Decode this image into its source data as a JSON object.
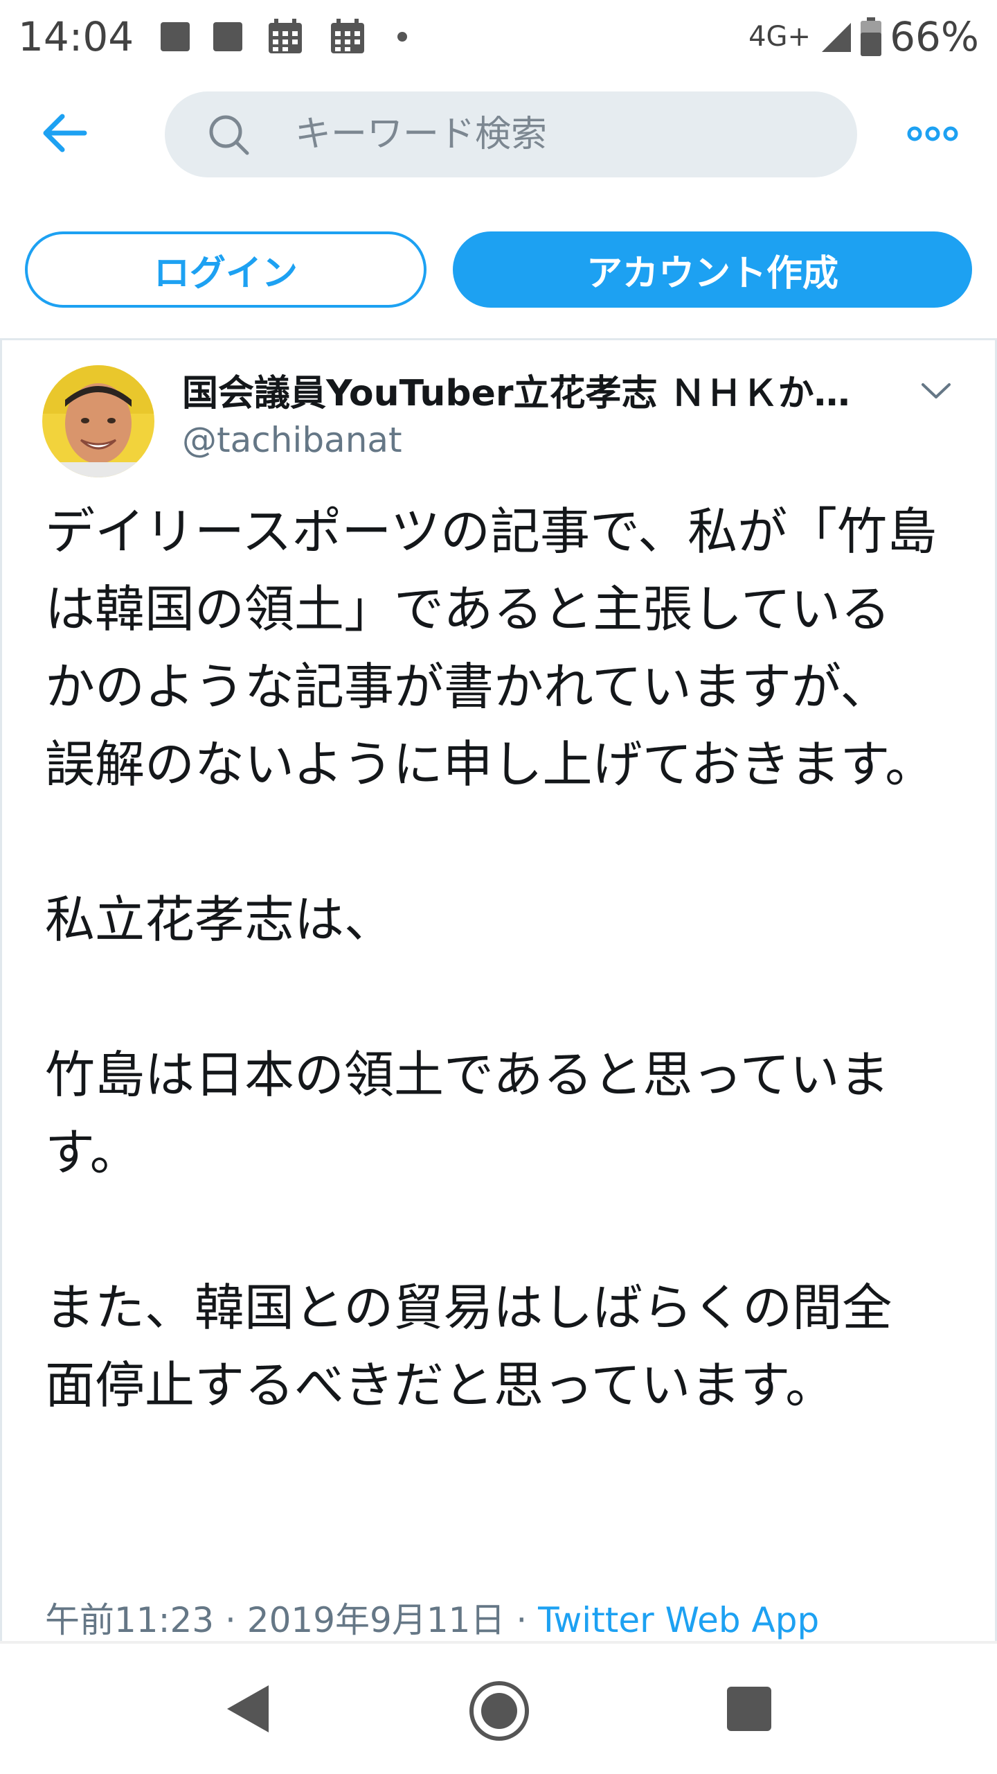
{
  "status_bar": {
    "time": "14:04",
    "network": "4G+",
    "battery": "66%"
  },
  "header": {
    "search_placeholder": "キーワード検索"
  },
  "auth": {
    "login_label": "ログイン",
    "signup_label": "アカウント作成"
  },
  "tweet": {
    "display_name": "国会議員YouTuber立花孝志 ＮＨＫか…",
    "username": "@tachibanat",
    "paragraphs": [
      "デイリースポーツの記事で、私が「竹島は韓国の領土」であると主張しているかのような記事が書かれていますが、誤解のないように申し上げておきます。",
      "私立花孝志は、",
      "竹島は日本の領土であると思っています。",
      "また、韓国との貿易はしばらくの間全面停止するべきだと思っています。"
    ],
    "timestamp": "午前11:23 · 2019年9月11日 · ",
    "source": "Twitter Web App"
  },
  "colors": {
    "accent": "#1da1f2",
    "search_bg": "#e6ecf0",
    "secondary_text": "#657786",
    "primary_text": "#14171a"
  },
  "icons": {
    "back": "arrow-left-icon",
    "search": "search-icon",
    "more": "more-dots-icon",
    "chevron": "chevron-down-icon",
    "nav_back": "triangle-back-icon",
    "nav_home": "circle-home-icon",
    "nav_recents": "square-recents-icon"
  }
}
